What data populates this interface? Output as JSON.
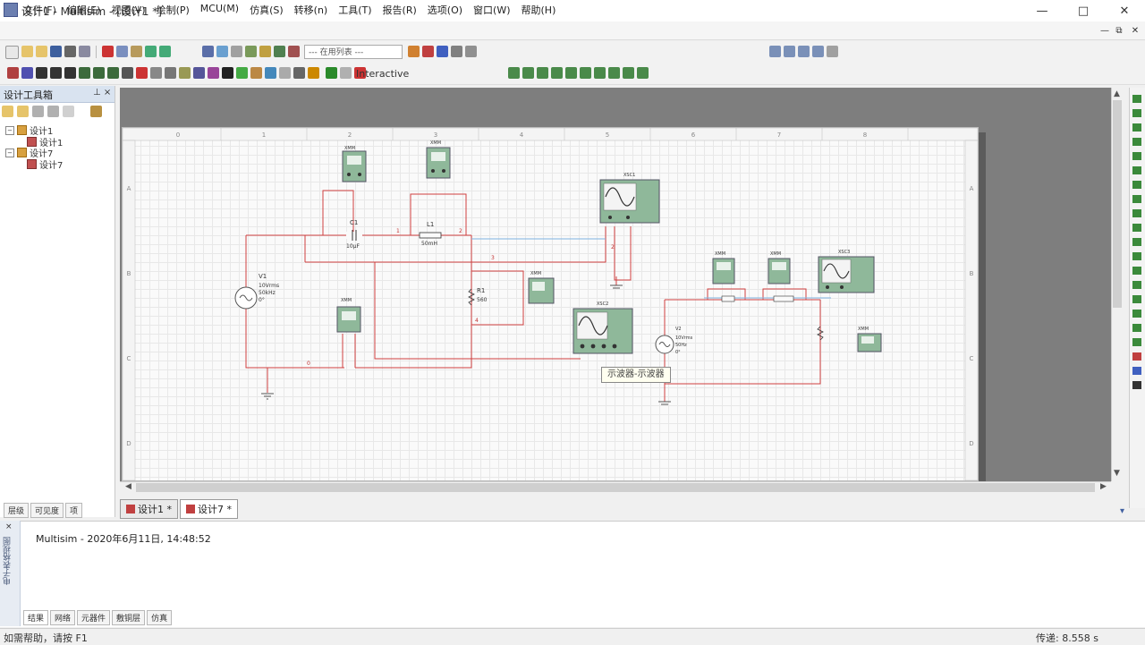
{
  "window": {
    "title": "设计1 - Multisim - [设计1 *]",
    "minimize": "—",
    "maximize": "□",
    "close": "✕"
  },
  "menu": {
    "items": [
      "文件(F)",
      "编辑(E)",
      "视图(V)",
      "绘制(P)",
      "MCU(M)",
      "仿真(S)",
      "转移(n)",
      "工具(T)",
      "报告(R)",
      "选项(O)",
      "窗口(W)",
      "帮助(H)"
    ],
    "mdi_minimize": "—",
    "mdi_restore": "⧉",
    "mdi_close": "✕"
  },
  "toolbar": {
    "in_use_list": "--- 在用列表 ---",
    "interactive": "Interactive"
  },
  "toolbox": {
    "title": "设计工具箱",
    "buttons": "⊥ ×",
    "tree": [
      {
        "label": "设计1",
        "level": 0,
        "expander": "−"
      },
      {
        "label": "设计1",
        "level": 1
      },
      {
        "label": "设计7",
        "level": 0,
        "expander": "−"
      },
      {
        "label": "设计7",
        "level": 1
      }
    ],
    "tabs": [
      "层级",
      "可见度",
      "项"
    ]
  },
  "schematic": {
    "ruler_top": [
      "0",
      "1",
      "2",
      "3",
      "4",
      "5",
      "6",
      "7",
      "8"
    ],
    "ruler_left": [
      "A",
      "B",
      "C",
      "D"
    ],
    "components": {
      "v1": {
        "name": "V1",
        "line1": "10Vrms",
        "line2": "50kHz",
        "line3": "0°"
      },
      "c1": {
        "name": "C1",
        "value": "10µF"
      },
      "l1": {
        "name": "L1",
        "value": "50mH"
      },
      "r1": {
        "name": "R1",
        "value": "560"
      },
      "v2": {
        "name": "V2",
        "line1": "10Vrms",
        "line2": "50Hz",
        "line3": "0°"
      }
    },
    "instruments": {
      "xmm_label": "XMM",
      "xsc1": "XSC1",
      "xsc2": "XSC2",
      "xsc3": "XSC3"
    },
    "nets": [
      "1",
      "2",
      "3",
      "4",
      "0"
    ],
    "tooltip": "示波器-示波器"
  },
  "doc_tabs": [
    {
      "label": "设计1 *",
      "active": false
    },
    {
      "label": "设计7 *",
      "active": true
    }
  ],
  "output": {
    "side_label": "电子表格视图",
    "message": "Multisim  -  2020年6月11日, 14:48:52",
    "tabs": [
      "结果",
      "网络",
      "元器件",
      "敷铜层",
      "仿真"
    ]
  },
  "status": {
    "left": "如需帮助，请按 F1",
    "right": "传递: 8.558 s"
  }
}
